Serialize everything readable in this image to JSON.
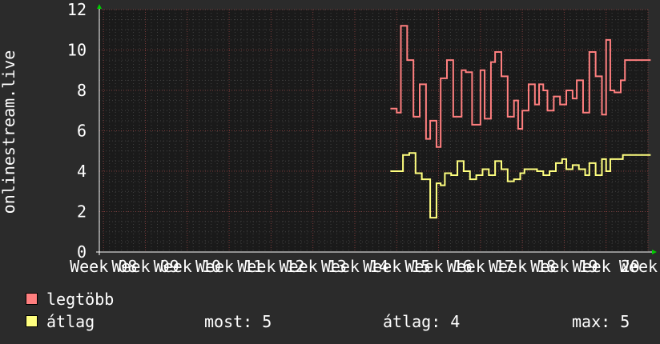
{
  "chart_data": {
    "type": "line",
    "ylabel": "onlinestream.live",
    "ylim": [
      0,
      12
    ],
    "yticks": [
      0,
      2,
      4,
      6,
      8,
      10,
      12
    ],
    "x_tick_labels": [
      "Week 08",
      "Week 09",
      "Week 10",
      "Week 11",
      "Week 12",
      "Week 13",
      "Week 14",
      "Week 15",
      "Week 16",
      "Week 17",
      "Week 18",
      "Week 19",
      "Week 20",
      "Week 2"
    ],
    "x_range_weeks": [
      7.9,
      21.0
    ],
    "grid": true,
    "series": [
      {
        "name": "legtöbb",
        "color": "#ff7f7f",
        "x": [
          14.85,
          15.0,
          15.1,
          15.25,
          15.4,
          15.55,
          15.7,
          15.8,
          15.95,
          16.05,
          16.2,
          16.35,
          16.55,
          16.65,
          16.8,
          17.0,
          17.1,
          17.25,
          17.35,
          17.5,
          17.65,
          17.8,
          17.9,
          18.0,
          18.15,
          18.3,
          18.4,
          18.5,
          18.6,
          18.75,
          18.9,
          19.05,
          19.2,
          19.3,
          19.45,
          19.6,
          19.75,
          19.9,
          20.0,
          20.1,
          20.2,
          20.35,
          20.45,
          20.55,
          20.65,
          20.75,
          20.85,
          20.95
        ],
        "values": [
          7.1,
          6.9,
          11.2,
          9.5,
          6.7,
          8.3,
          5.6,
          6.5,
          5.2,
          8.6,
          9.5,
          6.7,
          9.0,
          8.9,
          6.3,
          9.0,
          6.6,
          9.4,
          9.9,
          8.7,
          6.7,
          7.5,
          6.1,
          7.0,
          8.3,
          7.3,
          8.3,
          8.0,
          7.0,
          7.7,
          7.3,
          8.0,
          7.6,
          8.5,
          6.9,
          9.9,
          8.7,
          6.8,
          10.5,
          8.0,
          7.9,
          8.5,
          9.5,
          9.5,
          9.5,
          9.5,
          9.5,
          9.5
        ]
      },
      {
        "name": "átlag",
        "color": "#ffff7f",
        "x": [
          14.85,
          15.0,
          15.15,
          15.3,
          15.45,
          15.6,
          15.7,
          15.8,
          15.95,
          16.05,
          16.15,
          16.3,
          16.45,
          16.6,
          16.75,
          16.9,
          17.05,
          17.2,
          17.35,
          17.5,
          17.65,
          17.8,
          17.95,
          18.05,
          18.2,
          18.35,
          18.5,
          18.65,
          18.8,
          18.95,
          19.05,
          19.2,
          19.35,
          19.5,
          19.6,
          19.75,
          19.9,
          20.0,
          20.1,
          20.25,
          20.4,
          20.5,
          20.6,
          20.75,
          20.85,
          20.95
        ],
        "values": [
          4.0,
          4.0,
          4.8,
          4.9,
          3.9,
          3.6,
          3.6,
          1.7,
          3.4,
          3.3,
          3.9,
          3.8,
          4.5,
          4.0,
          3.6,
          3.8,
          4.1,
          3.8,
          4.5,
          4.1,
          3.5,
          3.6,
          3.9,
          4.1,
          4.1,
          4.0,
          3.8,
          4.0,
          4.4,
          4.6,
          4.1,
          4.3,
          4.1,
          3.8,
          4.4,
          3.8,
          4.6,
          4.0,
          4.6,
          4.6,
          4.8,
          4.8,
          4.8,
          4.8,
          4.8,
          4.8
        ]
      }
    ],
    "legend": [
      {
        "label": "legtöbb",
        "color": "#ff7f7f"
      },
      {
        "label": "átlag",
        "color": "#ffff7f"
      }
    ],
    "stats": {
      "most_label": "most:",
      "most_value": "5",
      "atlag_label": "átlag:",
      "atlag_value": "4",
      "max_label": "max:",
      "max_value": "5"
    }
  }
}
